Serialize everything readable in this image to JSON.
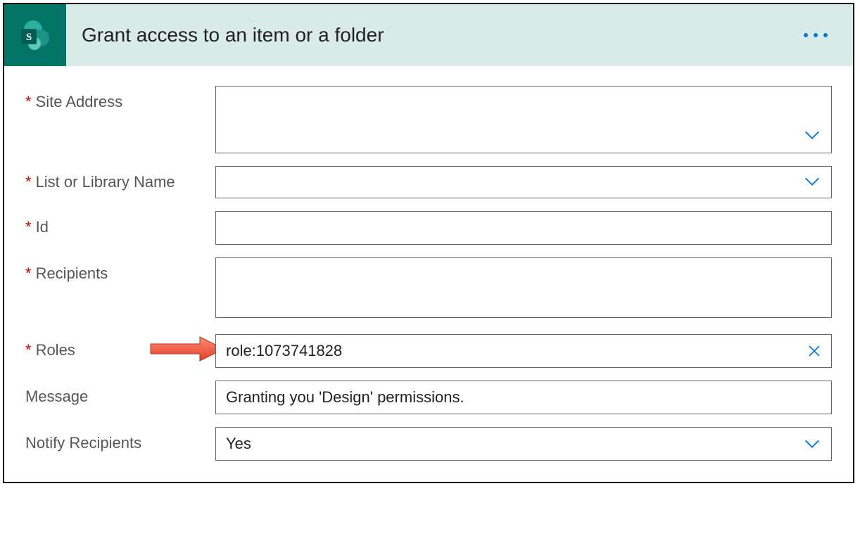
{
  "header": {
    "title": "Grant access to an item or a folder"
  },
  "fields": {
    "site_address": {
      "label": "Site Address",
      "required": true,
      "value": ""
    },
    "list_name": {
      "label": "List or Library Name",
      "required": true,
      "value": ""
    },
    "id": {
      "label": "Id",
      "required": true,
      "value": ""
    },
    "recipients": {
      "label": "Recipients",
      "required": true,
      "value": ""
    },
    "roles": {
      "label": "Roles",
      "required": true,
      "value": "role:1073741828"
    },
    "message": {
      "label": "Message",
      "required": false,
      "value": "Granting you 'Design' permissions."
    },
    "notify": {
      "label": "Notify Recipients",
      "required": false,
      "value": "Yes"
    }
  }
}
